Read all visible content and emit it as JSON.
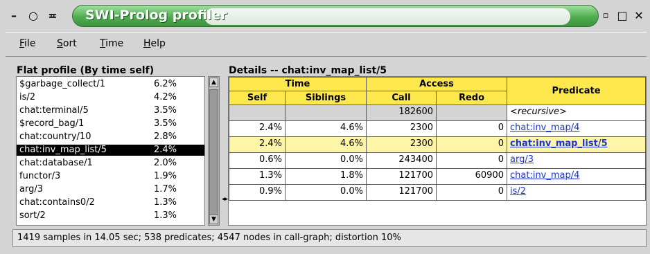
{
  "window": {
    "title": "SWI-Prolog profiler",
    "controls": [
      "–",
      "○",
      "≖"
    ],
    "right_controls": [
      "▫",
      "□",
      "✕"
    ]
  },
  "menu": {
    "items": [
      {
        "first": "F",
        "rest": "ile"
      },
      {
        "first": "S",
        "rest": "ort"
      },
      {
        "first": "T",
        "rest": "ime"
      },
      {
        "first": "H",
        "rest": "elp"
      }
    ]
  },
  "flat_profile": {
    "label": "Flat profile (By time self)",
    "rows": [
      {
        "name": "$garbage_collect/1",
        "pct": "6.2%"
      },
      {
        "name": "is/2",
        "pct": "4.2%"
      },
      {
        "name": "chat:terminal/5",
        "pct": "3.5%"
      },
      {
        "name": "$record_bag/1",
        "pct": "3.5%"
      },
      {
        "name": "chat:country/10",
        "pct": "2.8%"
      },
      {
        "name": "chat:inv_map_list/5",
        "pct": "2.4%",
        "selected": true
      },
      {
        "name": "chat:database/1",
        "pct": "2.0%"
      },
      {
        "name": "functor/3",
        "pct": "1.9%"
      },
      {
        "name": "arg/3",
        "pct": "1.7%"
      },
      {
        "name": "chat:contains0/2",
        "pct": "1.3%"
      },
      {
        "name": "sort/2",
        "pct": "1.3%"
      }
    ]
  },
  "details": {
    "label": "Details -- chat:inv_map_list/5",
    "headers": {
      "time": "Time",
      "access": "Access",
      "predicate": "Predicate",
      "self": "Self",
      "siblings": "Siblings",
      "call": "Call",
      "redo": "Redo"
    },
    "rows": [
      {
        "self": "",
        "siblings": "",
        "call": "182600",
        "redo": "",
        "predicate": "<recursive>",
        "kind": "recursive"
      },
      {
        "self": "2.4%",
        "siblings": "4.6%",
        "call": "2300",
        "redo": "0",
        "predicate": "chat:inv_map/4",
        "kind": "link"
      },
      {
        "self": "2.4%",
        "siblings": "4.6%",
        "call": "2300",
        "redo": "0",
        "predicate": "chat:inv_map_list/5",
        "kind": "current"
      },
      {
        "self": "0.6%",
        "siblings": "0.0%",
        "call": "243400",
        "redo": "0",
        "predicate": "arg/3",
        "kind": "link"
      },
      {
        "self": "1.3%",
        "siblings": "1.8%",
        "call": "121700",
        "redo": "60900",
        "predicate": "chat:inv_map/4",
        "kind": "link"
      },
      {
        "self": "0.9%",
        "siblings": "0.0%",
        "call": "121700",
        "redo": "0",
        "predicate": "is/2",
        "kind": "link"
      }
    ]
  },
  "status": "1419 samples in 14.05 sec; 538 predicates; 4547 nodes in call-graph; distortion 10%",
  "colors": {
    "header_yellow": "#ffe84d",
    "highlight_row": "#fff5a6",
    "title_green": "#4fae4f",
    "link_blue": "#1a35d6"
  }
}
